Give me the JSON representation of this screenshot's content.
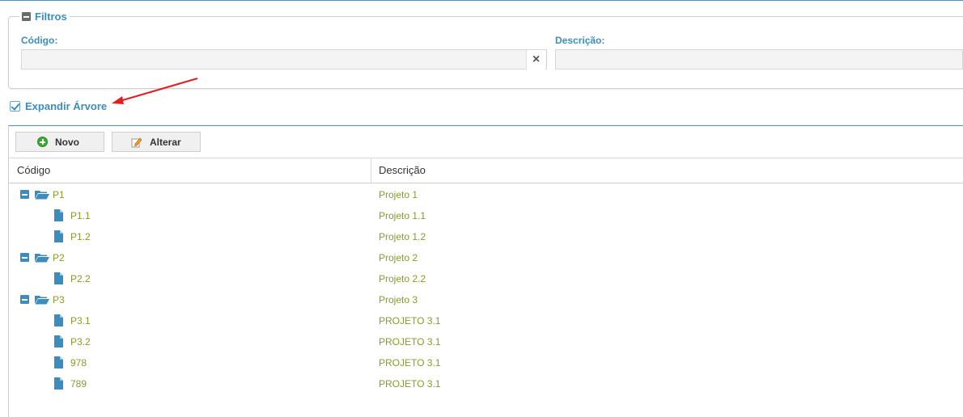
{
  "filters": {
    "legend": "Filtros",
    "codigo_label": "Código:",
    "codigo_value": "",
    "descricao_label": "Descrição:",
    "descricao_value": "",
    "clear_icon": "×"
  },
  "expand_tree": {
    "label": "Expandir Árvore",
    "checked": true
  },
  "toolbar": {
    "novo_label": "Novo",
    "alterar_label": "Alterar"
  },
  "grid": {
    "columns": [
      "Código",
      "Descrição"
    ],
    "rows": [
      {
        "codigo": "P1",
        "descricao": "Projeto 1",
        "level": 0,
        "type": "folder"
      },
      {
        "codigo": "P1.1",
        "descricao": "Projeto 1.1",
        "level": 1,
        "type": "file"
      },
      {
        "codigo": "P1.2",
        "descricao": "Projeto 1.2",
        "level": 1,
        "type": "file"
      },
      {
        "codigo": "P2",
        "descricao": "Projeto 2",
        "level": 0,
        "type": "folder"
      },
      {
        "codigo": "P2.2",
        "descricao": "Projeto 2.2",
        "level": 1,
        "type": "file"
      },
      {
        "codigo": "P3",
        "descricao": "Projeto 3",
        "level": 0,
        "type": "folder"
      },
      {
        "codigo": "P3.1",
        "descricao": "PROJETO 3.1",
        "level": 1,
        "type": "file"
      },
      {
        "codigo": "P3.2",
        "descricao": "PROJETO 3.1",
        "level": 1,
        "type": "file"
      },
      {
        "codigo": "978",
        "descricao": "PROJETO 3.1",
        "level": 1,
        "type": "file"
      },
      {
        "codigo": "789",
        "descricao": "PROJETO 3.1",
        "level": 1,
        "type": "file"
      }
    ]
  },
  "colors": {
    "accent": "#3c8dbc",
    "row_text": "#8a9a2c",
    "annotation_arrow": "#e02020"
  }
}
